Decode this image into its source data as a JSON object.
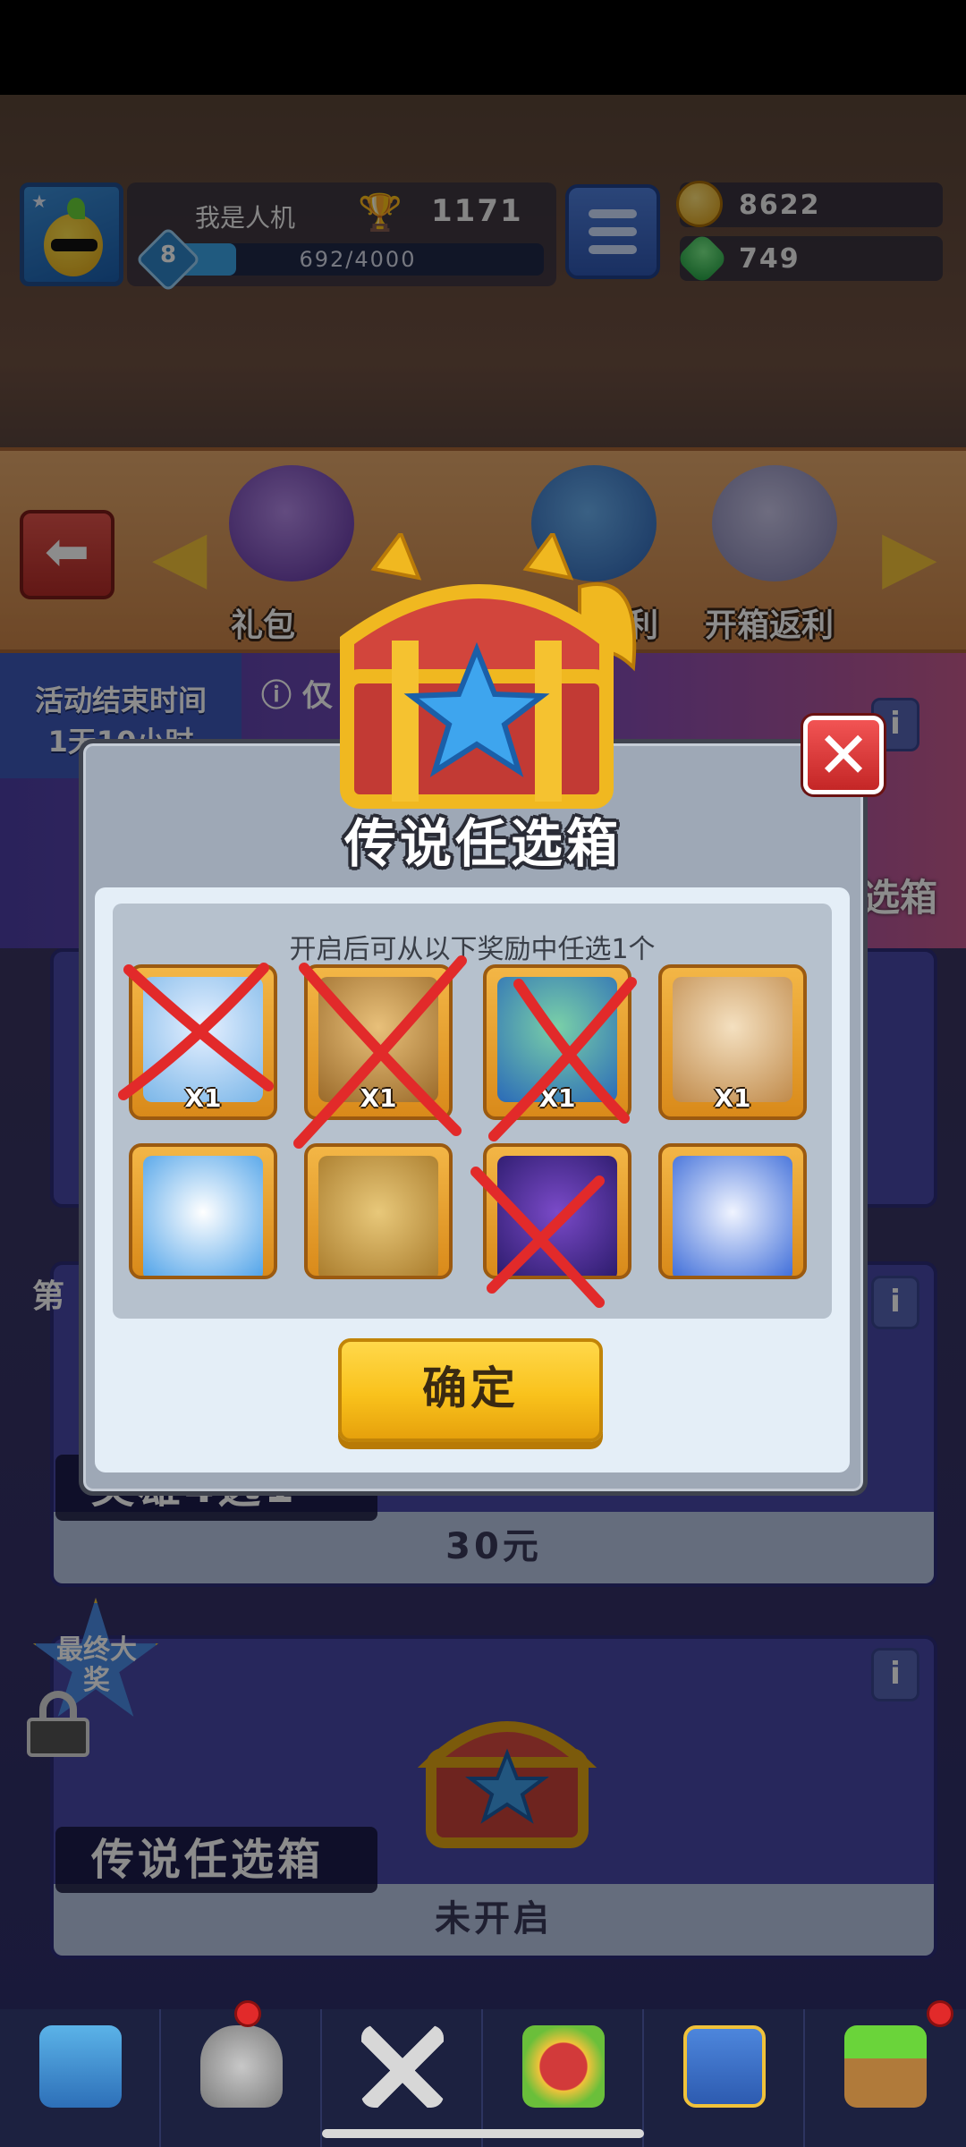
{
  "player": {
    "name": "我是人机",
    "trophies": "1171",
    "level": "8",
    "xp": "692/4000",
    "xp_progress": 0.173
  },
  "currencies": {
    "coins": "8622",
    "gems": "749"
  },
  "event_strip": {
    "items": [
      {
        "label": "礼包"
      },
      {
        "label": "利"
      },
      {
        "label": "开箱返利"
      }
    ]
  },
  "event_banner": {
    "end_time_label": "活动结束时间",
    "end_time_value": "1天10小时",
    "notice": "仅",
    "right_tag": "选箱"
  },
  "cards": {
    "middle": {
      "side_tag": "第",
      "title": "英雄4选1",
      "price": "30元"
    },
    "final": {
      "badge": "最终大奖",
      "title": "传说任选箱",
      "status": "未开启"
    }
  },
  "modal": {
    "title": "传说任选箱",
    "caption": "开启后可从以下奖励中任选1个",
    "confirm_label": "确定",
    "rewards": [
      {
        "qty": "X1",
        "crossed": true,
        "icon": "white-hair-hero-portrait"
      },
      {
        "qty": "X1",
        "crossed": true,
        "icon": "captain-hero-portrait"
      },
      {
        "qty": "X1",
        "crossed": true,
        "icon": "police-hero-portrait"
      },
      {
        "qty": "X1",
        "crossed": false,
        "icon": "monkey-king-hero-portrait"
      },
      {
        "qty": "",
        "crossed": false,
        "icon": "clown-hero-portrait"
      },
      {
        "qty": "",
        "crossed": false,
        "icon": "wood-hero-portrait"
      },
      {
        "qty": "",
        "crossed": true,
        "icon": "wizard-hero-portrait"
      },
      {
        "qty": "",
        "crossed": false,
        "icon": "robot-hero-portrait"
      }
    ]
  },
  "colors": {
    "accent_red": "#e22a2a",
    "confirm_yellow": "#f9c21c",
    "modal_bg": "#e4eef7"
  }
}
